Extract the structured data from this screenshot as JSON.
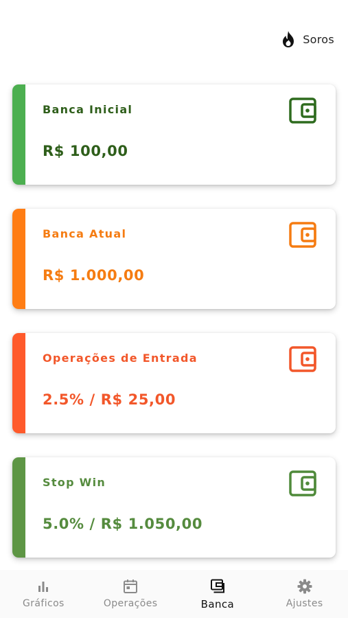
{
  "header": {
    "mode_label": "Soros",
    "mode_icon": "flame-icon"
  },
  "cards": [
    {
      "title": "Banca Inicial",
      "value": "R$ 100,00",
      "color": "#4CAF50",
      "text_color": "#2E5E1A",
      "icon_color": "#2E6B1E",
      "icon": "wallet-icon"
    },
    {
      "title": "Banca Atual",
      "value": "R$ 1.000,00",
      "color": "#FF7D14",
      "text_color": "#F57C12",
      "icon_color": "#F57C12",
      "icon": "wallet-icon"
    },
    {
      "title": "Operações de Entrada",
      "value": "2.5% / R$ 25,00",
      "color": "#FF5A2B",
      "text_color": "#F2572A",
      "icon_color": "#F2572A",
      "icon": "wallet-icon"
    },
    {
      "title": "Stop Win",
      "value": "5.0% / R$ 1.050,00",
      "color": "#5E9645",
      "text_color": "#558B3E",
      "icon_color": "#4F8A3A",
      "icon": "wallet-icon"
    }
  ],
  "nav": [
    {
      "label": "Gráficos",
      "icon": "bar-chart-icon",
      "active": false
    },
    {
      "label": "Operações",
      "icon": "calendar-icon",
      "active": false
    },
    {
      "label": "Banca",
      "icon": "wallet-stack-icon",
      "active": true
    },
    {
      "label": "Ajustes",
      "icon": "gear-icon",
      "active": false
    }
  ]
}
